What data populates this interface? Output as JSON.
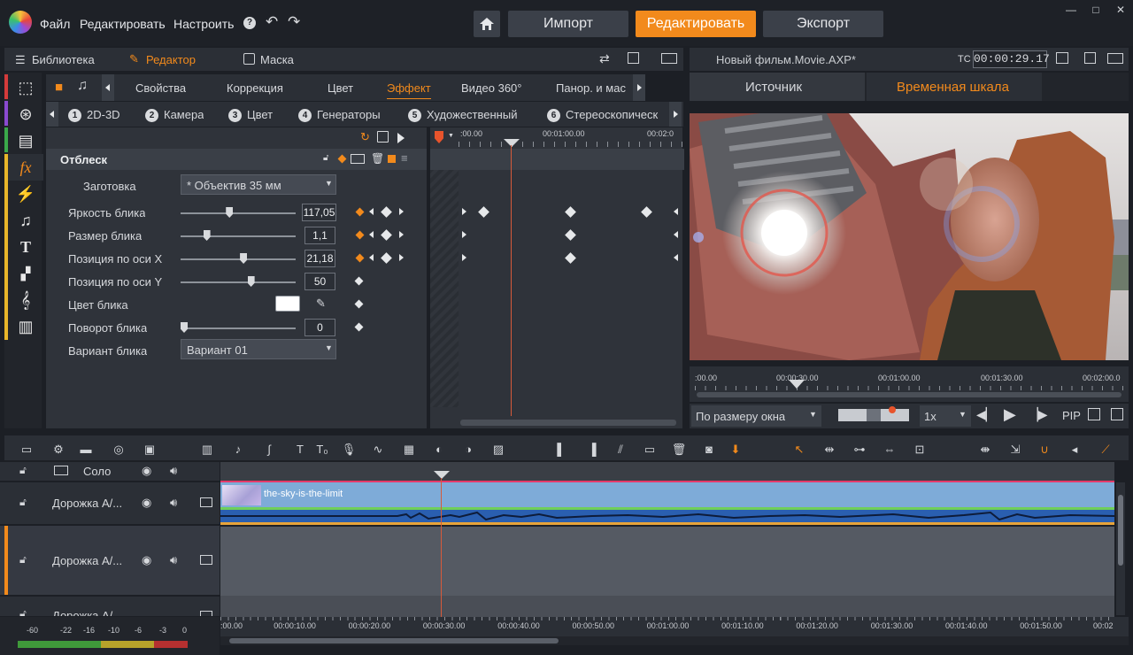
{
  "menu": {
    "file": "Файл",
    "edit": "Редактировать",
    "settings": "Настроить",
    "help": "?"
  },
  "modes": {
    "import": "Импорт",
    "edit": "Редактировать",
    "export": "Экспорт"
  },
  "window_controls": {
    "minimize": "—",
    "maximize": "□",
    "close": "✕"
  },
  "left_tabs": {
    "library": "Библиотека",
    "editor": "Редактор",
    "mask": "Маска"
  },
  "prop_tabs": [
    "Свойства",
    "Коррекция",
    "Цвет",
    "Эффект",
    "Видео 360°",
    "Панор. и мас"
  ],
  "effect_cats": [
    {
      "num": "1",
      "label": "2D-3D"
    },
    {
      "num": "2",
      "label": "Камера"
    },
    {
      "num": "3",
      "label": "Цвет"
    },
    {
      "num": "4",
      "label": "Генераторы"
    },
    {
      "num": "5",
      "label": "Художественный"
    },
    {
      "num": "6",
      "label": "Стереоскопическ"
    }
  ],
  "effect": {
    "name": "Отблеск",
    "preset_label": "Заготовка",
    "preset_value": "* Объектив 35 мм",
    "params": [
      {
        "label": "Яркость блика",
        "value": "117,05",
        "pos": 0.42
      },
      {
        "label": "Размер блика",
        "value": "1,1",
        "pos": 0.21
      },
      {
        "label": "Позиция по оси X",
        "value": "21,18",
        "pos": 0.55
      },
      {
        "label": "Позиция по оси Y",
        "value": "50",
        "pos": 0.62
      },
      {
        "label": "Цвет блика",
        "value": ""
      },
      {
        "label": "Поворот блика",
        "value": "0",
        "pos": 0.0
      },
      {
        "label": "Вариант блика",
        "value": "Вариант 01"
      }
    ]
  },
  "kf_ruler": {
    "t0": ":00.00",
    "t1": "00:01:00.00",
    "t2": "00:02:0"
  },
  "preview": {
    "title": "Новый фильм.Movie.AXP*",
    "tc_label": "TC",
    "timecode": "00:00:29.17",
    "tab_source": "Источник",
    "tab_timeline": "Временная шкала",
    "ruler": [
      ":00.00",
      "00:00:30.00",
      "00:01:00.00",
      "00:01:30.00",
      "00:02:00.0"
    ],
    "fit": "По размеру окна",
    "speed": "1x",
    "pip": "PIP"
  },
  "timeline": {
    "solo": "Соло",
    "tracks": [
      "Дорожка А/...",
      "Дорожка А/...",
      "Дорожка А/..."
    ],
    "clip_name": "the-sky-is-the-limit",
    "ruler": [
      ":00.00",
      "00:00:10.00",
      "00:00:20.00",
      "00:00:30.00",
      "00:00:40.00",
      "00:00:50.00",
      "00:01:00.00",
      "00:01:10.00",
      "00:01:20.00",
      "00:01:30.00",
      "00:01:40.00",
      "00:01:50.00",
      "00:02"
    ],
    "vu_labels": [
      "-60",
      "-22",
      "-16",
      "-10",
      "-6",
      "-3",
      "0"
    ]
  },
  "colors": {
    "accent": "#f28a1c",
    "panel": "#2b2f36",
    "bg": "#1c1f25",
    "clip": "#78a9d6",
    "playhead": "#d65a3a"
  }
}
